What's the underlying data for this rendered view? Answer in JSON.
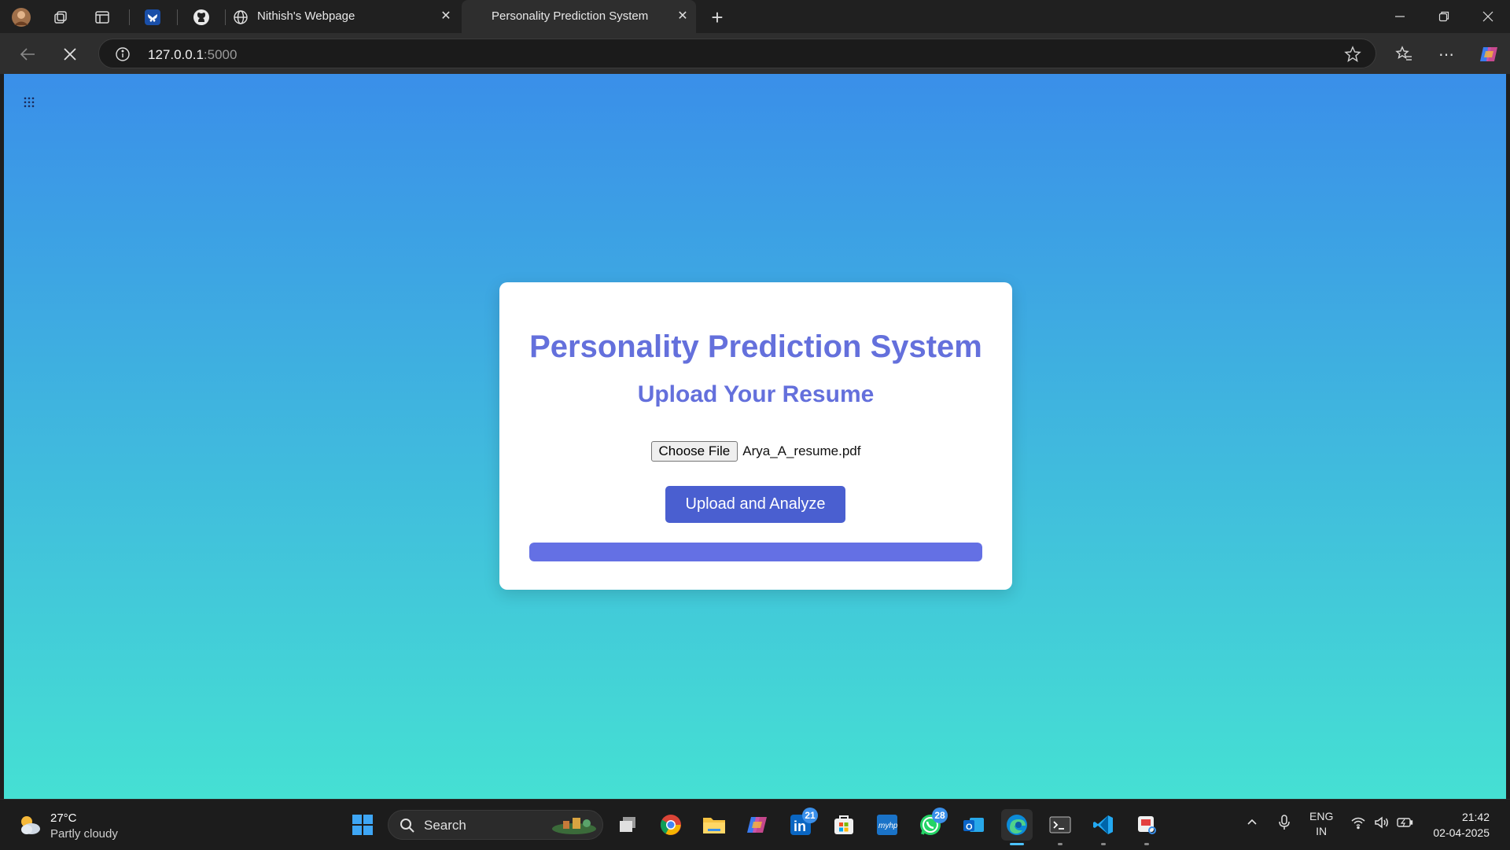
{
  "browser": {
    "tabs": [
      {
        "label": "Nithish's Webpage",
        "active": false
      },
      {
        "label": "Personality Prediction System",
        "active": true
      }
    ],
    "url_host": "127.0.0.1",
    "url_port": ":5000",
    "icons": [
      "profile-avatar-icon",
      "workspaces-icon",
      "vertical-tabs-icon",
      "bluesky-icon",
      "github-icon",
      "globe-icon",
      "new-tab-icon",
      "minimize-icon",
      "restore-icon",
      "close-icon",
      "back-icon",
      "stop-loading-icon",
      "site-info-icon",
      "favorite-star-icon",
      "favorites-icon",
      "more-menu-icon",
      "copilot-icon"
    ]
  },
  "page": {
    "title": "Personality Prediction System",
    "subtitle": "Upload Your Resume",
    "choose_file_label": "Choose File",
    "file_name": "Arya_A_resume.pdf",
    "upload_button_label": "Upload and Analyze",
    "progress": 1.0,
    "colors": {
      "accent": "#6470dc",
      "button": "#4a5fd0",
      "gradient_top": "#3a8fe9",
      "gradient_bottom": "#45e0d3"
    }
  },
  "taskbar": {
    "weather_temp": "27°C",
    "weather_condition": "Partly cloudy",
    "search_label": "Search",
    "linkedin_badge": "21",
    "whatsapp_badge": "28",
    "language_line1": "ENG",
    "language_line2": "IN",
    "time": "21:42",
    "date": "02-04-2025"
  }
}
